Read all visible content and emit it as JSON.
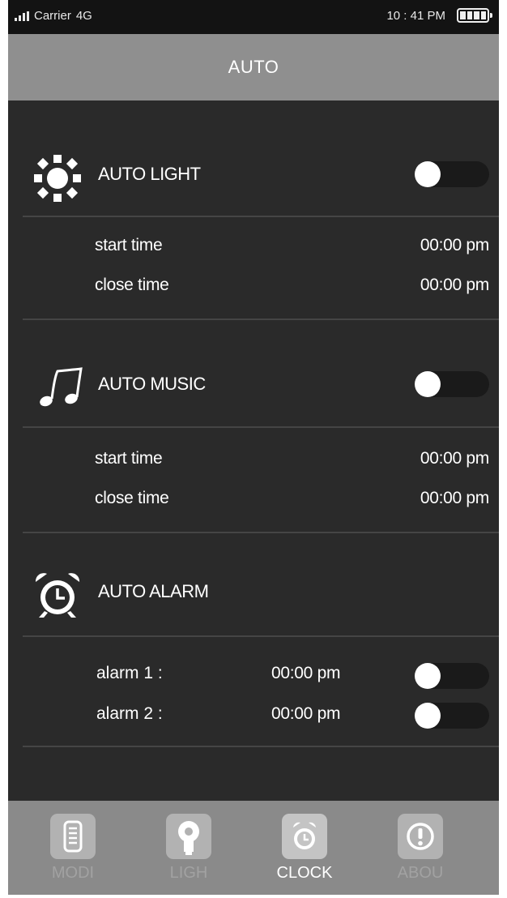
{
  "status_bar": {
    "carrier": "Carrier",
    "network": "4G",
    "time": "10 : 41 PM"
  },
  "header": {
    "title": "AUTO"
  },
  "sections": {
    "light": {
      "title": "AUTO LIGHT",
      "icon": "sun-icon",
      "toggle_on": false,
      "rows": [
        {
          "label": "start time",
          "value": "00:00 pm"
        },
        {
          "label": "close time",
          "value": "00:00 pm"
        }
      ]
    },
    "music": {
      "title": "AUTO MUSIC",
      "icon": "music-note-icon",
      "toggle_on": false,
      "rows": [
        {
          "label": "start time",
          "value": "00:00 pm"
        },
        {
          "label": "close time",
          "value": "00:00 pm"
        }
      ]
    },
    "alarm": {
      "title": "AUTO ALARM",
      "icon": "alarm-clock-icon",
      "alarms": [
        {
          "label": "alarm 1 :",
          "value": "00:00 pm",
          "toggle_on": false
        },
        {
          "label": "alarm 2 :",
          "value": "00:00 pm",
          "toggle_on": false
        }
      ]
    }
  },
  "nav": {
    "items": [
      {
        "label": "MODI",
        "icon": "document-icon",
        "active": false
      },
      {
        "label": "LIGH",
        "icon": "bulb-icon",
        "active": false
      },
      {
        "label": "CLOCK",
        "icon": "clock-icon",
        "active": true
      },
      {
        "label": "ABOU",
        "icon": "info-icon",
        "active": false
      }
    ]
  },
  "colors": {
    "background": "#2a2a2a",
    "status_bar": "#131313",
    "header": "#8f8f8f",
    "divider": "#454545",
    "toggle_track": "#1a1a1a",
    "nav_bar": "#8a8a8a",
    "nav_tile": "#b8b8b8",
    "text": "#ffffff"
  }
}
